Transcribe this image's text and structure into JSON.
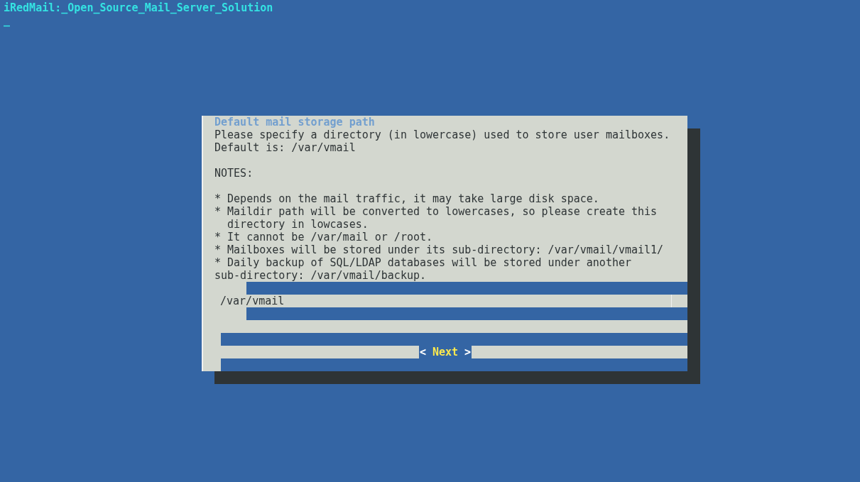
{
  "terminal_title": "iRedMail:_Open_Source_Mail_Server_Solution",
  "cursor": "_",
  "dialog": {
    "title": "Default mail storage path",
    "paragraphs": [
      [
        "Please specify a directory (in lowercase) used to store user mailboxes.",
        "Default is: /var/vmail"
      ],
      [
        "NOTES:"
      ],
      [
        "* Depends on the mail traffic, it may take large disk space.",
        "* Maildir path will be converted to lowercases, so please create this",
        "  directory in lowcases.",
        "* It cannot be /var/mail or /root.",
        "* Mailboxes will be stored under its sub-directory: /var/vmail/vmail1/",
        "* Daily backup of SQL/LDAP databases will be stored under another",
        "sub-directory: /var/vmail/backup."
      ]
    ],
    "input": {
      "value": "/var/vmail"
    },
    "button": {
      "left": "<",
      "label": "Next",
      "right": ">"
    }
  }
}
